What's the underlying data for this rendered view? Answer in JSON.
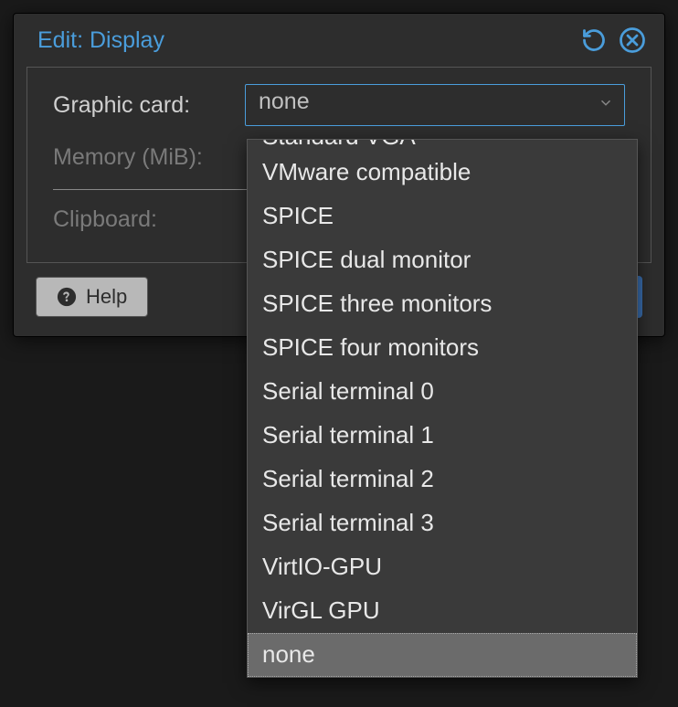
{
  "dialog": {
    "title": "Edit: Display"
  },
  "form": {
    "graphic_card": {
      "label": "Graphic card:",
      "value": "none"
    },
    "memory": {
      "label": "Memory (MiB):"
    },
    "clipboard": {
      "label": "Clipboard:"
    }
  },
  "footer": {
    "help_label": "Help"
  },
  "dropdown": {
    "partial_top": "Standard VGA",
    "items": [
      "VMware compatible",
      "SPICE",
      "SPICE dual monitor",
      "SPICE three monitors",
      "SPICE four monitors",
      "Serial terminal 0",
      "Serial terminal 1",
      "Serial terminal 2",
      "Serial terminal 3",
      "VirtIO-GPU",
      "VirGL GPU",
      "none"
    ],
    "selected_index": 11
  },
  "colors": {
    "accent": "#4a9ddb",
    "dialog_bg": "#2d2d2d",
    "dropdown_bg": "#3a3a3a",
    "selected_bg": "#6b6b6b"
  }
}
